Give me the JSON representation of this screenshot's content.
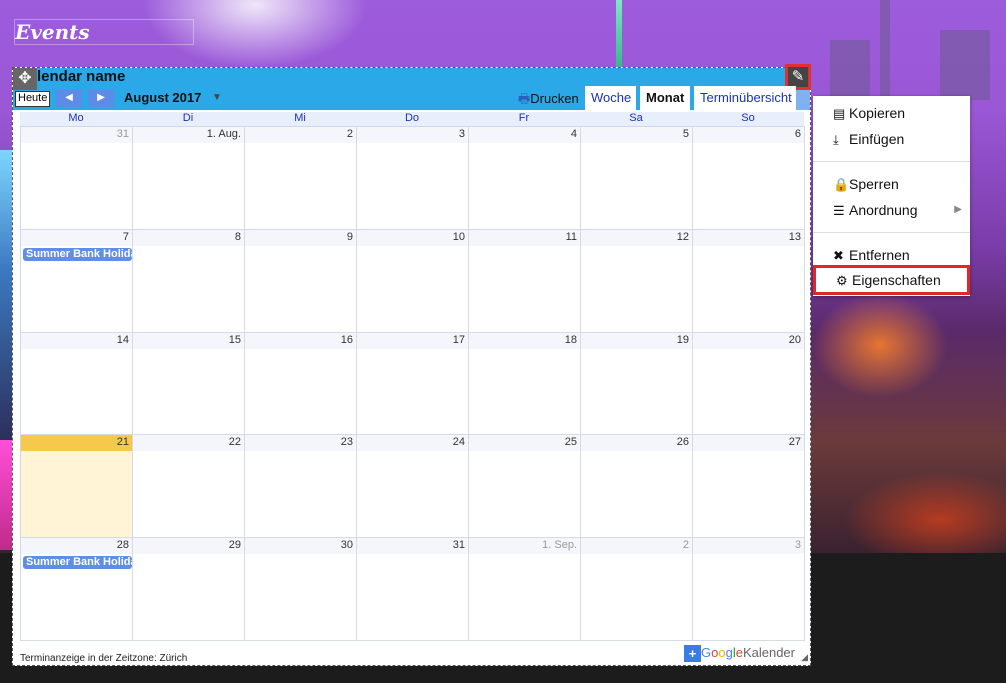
{
  "page": {
    "title": "Events"
  },
  "calendar": {
    "name": "lendar name",
    "today_label": "Heute",
    "prev_icon": "◀",
    "next_icon": "▶",
    "month_label": "August 2017",
    "print_label": "Drucken",
    "tabs": [
      {
        "label": "Woche",
        "active": false
      },
      {
        "label": "Monat",
        "active": true
      },
      {
        "label": "Terminübersicht",
        "active": false
      }
    ],
    "weekdays": [
      "Mo",
      "Di",
      "Mi",
      "Do",
      "Fr",
      "Sa",
      "So"
    ],
    "weeks": [
      [
        "31",
        "1. Aug.",
        "2",
        "3",
        "4",
        "5",
        "6"
      ],
      [
        "7",
        "8",
        "9",
        "10",
        "11",
        "12",
        "13"
      ],
      [
        "14",
        "15",
        "16",
        "17",
        "18",
        "19",
        "20"
      ],
      [
        "21",
        "22",
        "23",
        "24",
        "25",
        "26",
        "27"
      ],
      [
        "28",
        "29",
        "30",
        "31",
        "1. Sep.",
        "2",
        "3"
      ]
    ],
    "events": [
      {
        "week": 1,
        "day": 0,
        "title": "Summer Bank Holiday"
      },
      {
        "week": 4,
        "day": 0,
        "title": "Summer Bank Holiday"
      }
    ],
    "timezone_note": "Terminanzeige in der Zeitzone: Zürich",
    "google_plus": "+",
    "google_word": [
      "G",
      "o",
      "o",
      "g",
      "l",
      "e"
    ],
    "google_kalender": "Kalender",
    "colors": {
      "header": "#2aa8e8",
      "event": "#5e8ee6",
      "today": "#f6c84c",
      "highlight": "#e02828"
    }
  },
  "menu": {
    "items": [
      {
        "icon": "copy-icon",
        "glyph": "▤",
        "label": "Kopieren"
      },
      {
        "icon": "download-icon",
        "glyph": "⤓",
        "label": "Einfügen"
      },
      {
        "icon": "lock-icon",
        "glyph": "🔒",
        "label": "Sperren"
      },
      {
        "icon": "list-icon",
        "glyph": "☰",
        "label": "Anordnung"
      },
      {
        "icon": "close-icon",
        "glyph": "✖",
        "label": "Entfernen"
      },
      {
        "icon": "gear-icon",
        "glyph": "⚙",
        "label": "Eigenschaften"
      }
    ]
  }
}
